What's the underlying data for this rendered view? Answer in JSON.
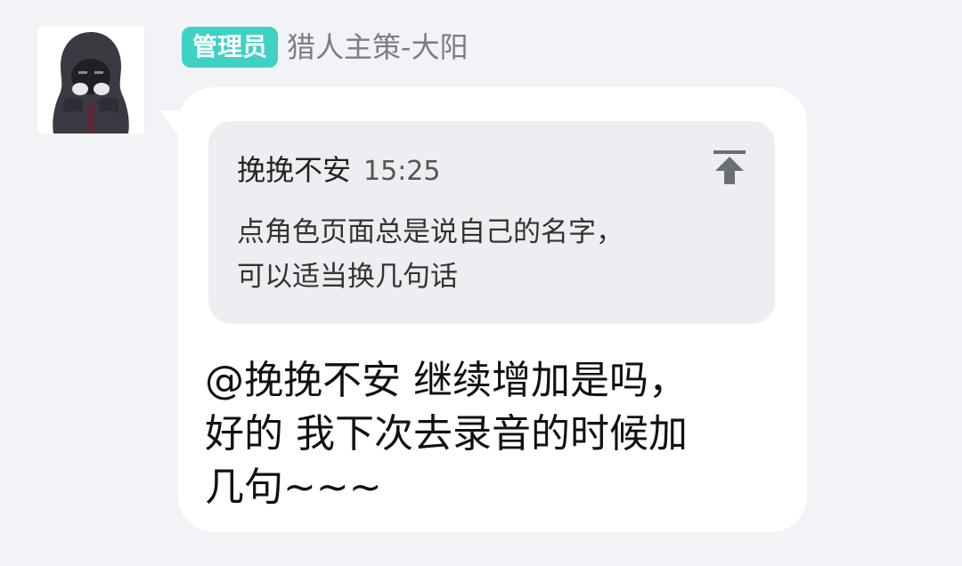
{
  "sender": {
    "role_badge": "管理员",
    "name": "猎人主策-大阳",
    "avatar_icon": "hooded-figure-avatar"
  },
  "quote": {
    "author": "挽挽不安",
    "time": "15:25",
    "lines": [
      "点角色页面总是说自己的名字，",
      "可以适当换几句话"
    ],
    "collapse_icon": "collapse-up-arrow-icon"
  },
  "message": {
    "lines": [
      "@挽挽不安 继续增加是吗，",
      "好的 我下次去录音的时候加",
      "几句~~~"
    ]
  },
  "colors": {
    "background": "#f2f3f7",
    "badge": "#3fd2c4",
    "bubble": "#ffffff",
    "quote_bg": "#eceef2"
  }
}
